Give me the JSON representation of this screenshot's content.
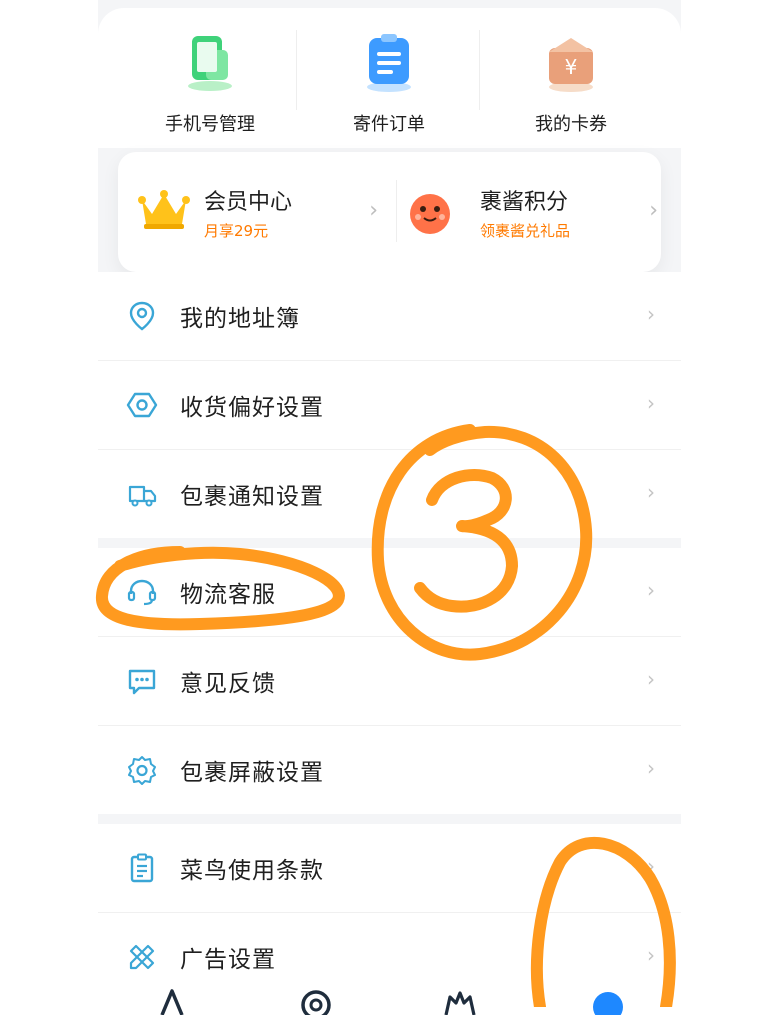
{
  "quick_actions": [
    {
      "label": "手机号管理",
      "icon": "phone-manage-icon"
    },
    {
      "label": "寄件订单",
      "icon": "shipping-order-icon"
    },
    {
      "label": "我的卡券",
      "icon": "coupon-icon"
    }
  ],
  "member_center": {
    "title": "会员中心",
    "subtitle": "月享29元"
  },
  "points": {
    "title": "裹酱积分",
    "subtitle": "领裹酱兑礼品"
  },
  "menu_group_1": [
    {
      "label": "我的地址簿",
      "icon": "location-pin-icon"
    },
    {
      "label": "收货偏好设置",
      "icon": "hexagon-settings-icon"
    },
    {
      "label": "包裹通知设置",
      "icon": "delivery-truck-icon"
    }
  ],
  "menu_group_2": [
    {
      "label": "物流客服",
      "icon": "headset-icon"
    },
    {
      "label": "意见反馈",
      "icon": "chat-bubble-icon"
    },
    {
      "label": "包裹屏蔽设置",
      "icon": "gear-icon"
    }
  ],
  "menu_group_3": [
    {
      "label": "菜鸟使用条款",
      "icon": "document-icon"
    },
    {
      "label": "广告设置",
      "icon": "pencil-ruler-icon"
    }
  ],
  "chevron": "›",
  "annotation": {
    "digit": "3",
    "color": "#ff9a1f"
  },
  "colors": {
    "brand_blue": "#1e88ff",
    "accent_orange": "#ff7a00",
    "icon_blue": "#3aa6d6"
  }
}
